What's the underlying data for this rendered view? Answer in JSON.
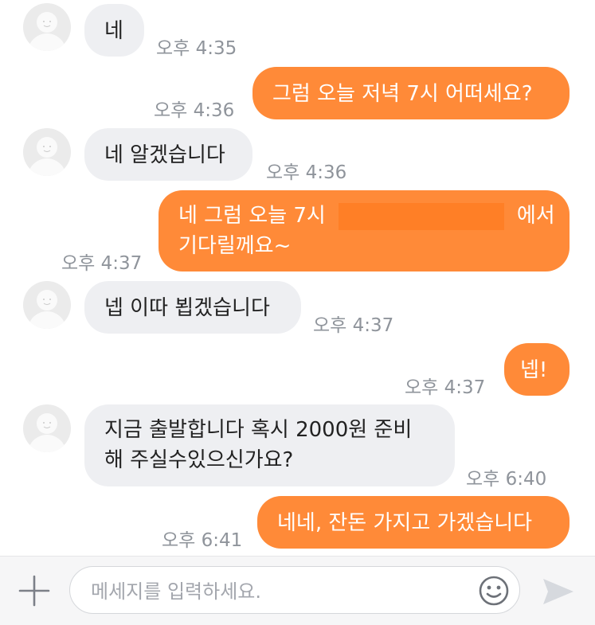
{
  "messages": [
    {
      "side": "in",
      "text": "네",
      "time": "오후 4:35"
    },
    {
      "side": "out",
      "text": "그럼 오늘 저녁 7시 어떠세요?",
      "time": "오후 4:36"
    },
    {
      "side": "in",
      "text": "네 알겠습니다",
      "time": "오후 4:36"
    },
    {
      "side": "out",
      "text_before": "네 그럼 오늘 7시",
      "text_after": "에서",
      "text_line2": "기다릴께요~",
      "time": "오후 4:37"
    },
    {
      "side": "in",
      "text": "넵 이따 뵙겠습니다",
      "time": "오후 4:37"
    },
    {
      "side": "out",
      "text": "넵!",
      "time": "오후 4:37"
    },
    {
      "side": "in",
      "line1": "지금 출발합니다 혹시 2000원 준비",
      "line2": "해 주실수있으신가요?",
      "time": "오후 6:40"
    },
    {
      "side": "out",
      "text": "네네, 잔돈 가지고 가겠습니다",
      "time": "오후 6:41"
    }
  ],
  "composer": {
    "placeholder": "메세지를 입력하세요.",
    "value": ""
  },
  "icons": {
    "add": "plus-icon",
    "emoji": "smiley-icon",
    "send": "send-icon",
    "avatar": "default-avatar-icon"
  },
  "colors": {
    "outgoing_bubble": "#ff8a38",
    "incoming_bubble": "#eeeff2",
    "timestamp": "#8f949b"
  }
}
